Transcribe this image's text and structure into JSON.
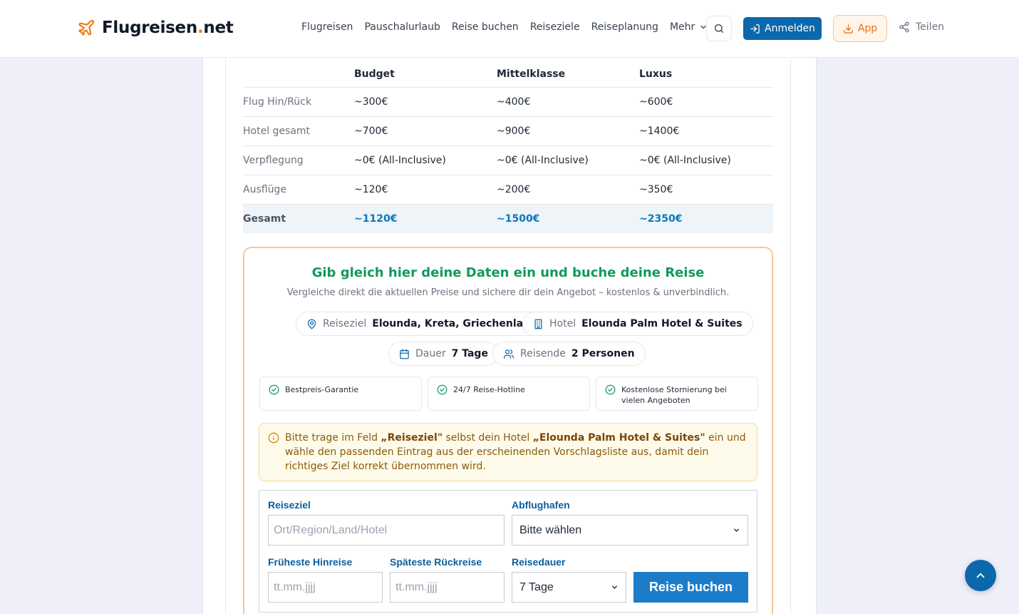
{
  "header": {
    "logo_main": "Flugreisen",
    "logo_dot": ".",
    "logo_tld": "net",
    "nav": [
      "Flugreisen",
      "Pauschalurlaub",
      "Reise buchen",
      "Reiseziele",
      "Reiseplanung"
    ],
    "nav_more": "Mehr",
    "login_label": "Anmelden",
    "app_label": "App",
    "share_label": "Teilen"
  },
  "cost_table": {
    "headers": [
      "",
      "Budget",
      "Mittelklasse",
      "Luxus"
    ],
    "rows": [
      {
        "label": "Flug Hin/Rück",
        "budget": "~300€",
        "mid": "~400€",
        "luxury": "~600€"
      },
      {
        "label": "Hotel gesamt",
        "budget": "~700€",
        "mid": "~900€",
        "luxury": "~1400€"
      },
      {
        "label": "Verpflegung",
        "budget": "~0€ (All-Inclusive)",
        "mid": "~0€ (All-Inclusive)",
        "luxury": "~0€ (All-Inclusive)"
      },
      {
        "label": "Ausflüge",
        "budget": "~120€",
        "mid": "~200€",
        "luxury": "~350€"
      }
    ],
    "total": {
      "label": "Gesamt",
      "budget": "~1120€",
      "mid": "~1500€",
      "luxury": "~2350€"
    }
  },
  "booking": {
    "title": "Gib gleich hier deine Daten ein und buche deine Reise",
    "subtitle": "Vergleiche direkt die aktuellen Preise und sichere dir dein Angebot – kostenlos & unverbindlich.",
    "pills": {
      "destination_label": "Reiseziel",
      "destination_value": "Elounda, Kreta, Griechenland",
      "hotel_label": "Hotel",
      "hotel_value": "Elounda Palm Hotel & Suites",
      "duration_label": "Dauer",
      "duration_value": "7 Tage",
      "travelers_label": "Reisende",
      "travelers_value": "2 Personen"
    },
    "features": [
      "Bestpreis-Garantie",
      "24/7 Reise-Hotline",
      "Kostenlose Stornierung bei vielen Angeboten"
    ],
    "notice": {
      "part1": "Bitte trage im Feld ",
      "field": "„Reiseziel\"",
      "part2": " selbst dein Hotel ",
      "hotel": "„Elounda Palm Hotel & Suites\"",
      "part3": " ein und wähle den passenden Eintrag aus der erscheinenden Vorschlagsliste aus, damit dein richtiges Ziel korrekt übernommen wird."
    },
    "form": {
      "destination_label": "Reiseziel",
      "destination_placeholder": "Ort/Region/Land/Hotel",
      "airport_label": "Abflughafen",
      "airport_value": "Bitte wählen",
      "earliest_label": "Früheste Hinreise",
      "earliest_placeholder": "tt.mm.jjjj",
      "latest_label": "Späteste Rückreise",
      "latest_placeholder": "tt.mm.jjjj",
      "duration_label": "Reisedauer",
      "duration_value": "7 Tage",
      "submit_label": "Reise buchen"
    }
  },
  "colors": {
    "primary": "#0b68ad",
    "accent_orange": "#f07c14",
    "title_green": "#0f9a5c",
    "total_blue": "#0b79b8"
  }
}
